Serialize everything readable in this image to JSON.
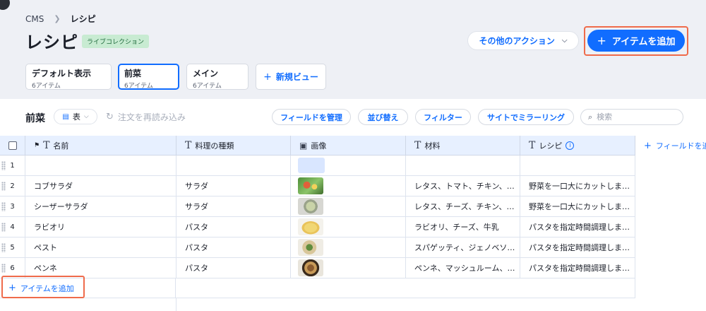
{
  "breadcrumb": {
    "root": "CMS",
    "current": "レシピ"
  },
  "page": {
    "title": "レシピ",
    "badge": "ライブコレクション"
  },
  "actions": {
    "more": "その他のアクション",
    "add_item": "アイテムを追加"
  },
  "views": [
    {
      "name": "デフォルト表示",
      "count": "6アイテム",
      "active": false
    },
    {
      "name": "前菜",
      "count": "6アイテム",
      "active": true
    },
    {
      "name": "メイン",
      "count": "6アイテム",
      "active": false
    }
  ],
  "new_view": "新規ビュー",
  "toolbar": {
    "title": "前菜",
    "view_mode": "表",
    "reload": "注文を再読み込み",
    "manage_fields": "フィールドを管理",
    "sort": "並び替え",
    "filter": "フィルター",
    "mirror": "サイトでミラーリング",
    "search_placeholder": "検索"
  },
  "columns": {
    "name": "名前",
    "type": "料理の種類",
    "image": "画像",
    "ingredients": "材料",
    "recipe": "レシピ",
    "add_field": "フィールドを追"
  },
  "rows": [
    {
      "num": "1",
      "name": "",
      "type": "",
      "ingredients": "",
      "recipe": "",
      "img": ""
    },
    {
      "num": "2",
      "name": "コブサラダ",
      "type": "サラダ",
      "ingredients": "レタス、トマト、チキン、…",
      "recipe": "野菜を一口大にカットしま…",
      "img": "salad-green"
    },
    {
      "num": "3",
      "name": "シーザーサラダ",
      "type": "サラダ",
      "ingredients": "レタス、チーズ、チキン、…",
      "recipe": "野菜を一口大にカットしま…",
      "img": "salad-bowl"
    },
    {
      "num": "4",
      "name": "ラビオリ",
      "type": "パスタ",
      "ingredients": "ラビオリ、チーズ、牛乳",
      "recipe": "パスタを指定時間調理しま…",
      "img": "pasta-yellow"
    },
    {
      "num": "5",
      "name": "ペスト",
      "type": "パスタ",
      "ingredients": "スパゲッティ、ジェノベソ…",
      "recipe": "パスタを指定時間調理しま…",
      "img": "pasta-green"
    },
    {
      "num": "6",
      "name": "ペンネ",
      "type": "パスタ",
      "ingredients": "ペンネ、マッシュルーム、…",
      "recipe": "パスタを指定時間調理しま…",
      "img": "pasta-brown"
    }
  ],
  "add_item_bottom": "アイテムを追加",
  "colors": {
    "accent": "#116dff",
    "highlight": "#ef6b4b",
    "badge_bg": "#c8ebd2"
  }
}
